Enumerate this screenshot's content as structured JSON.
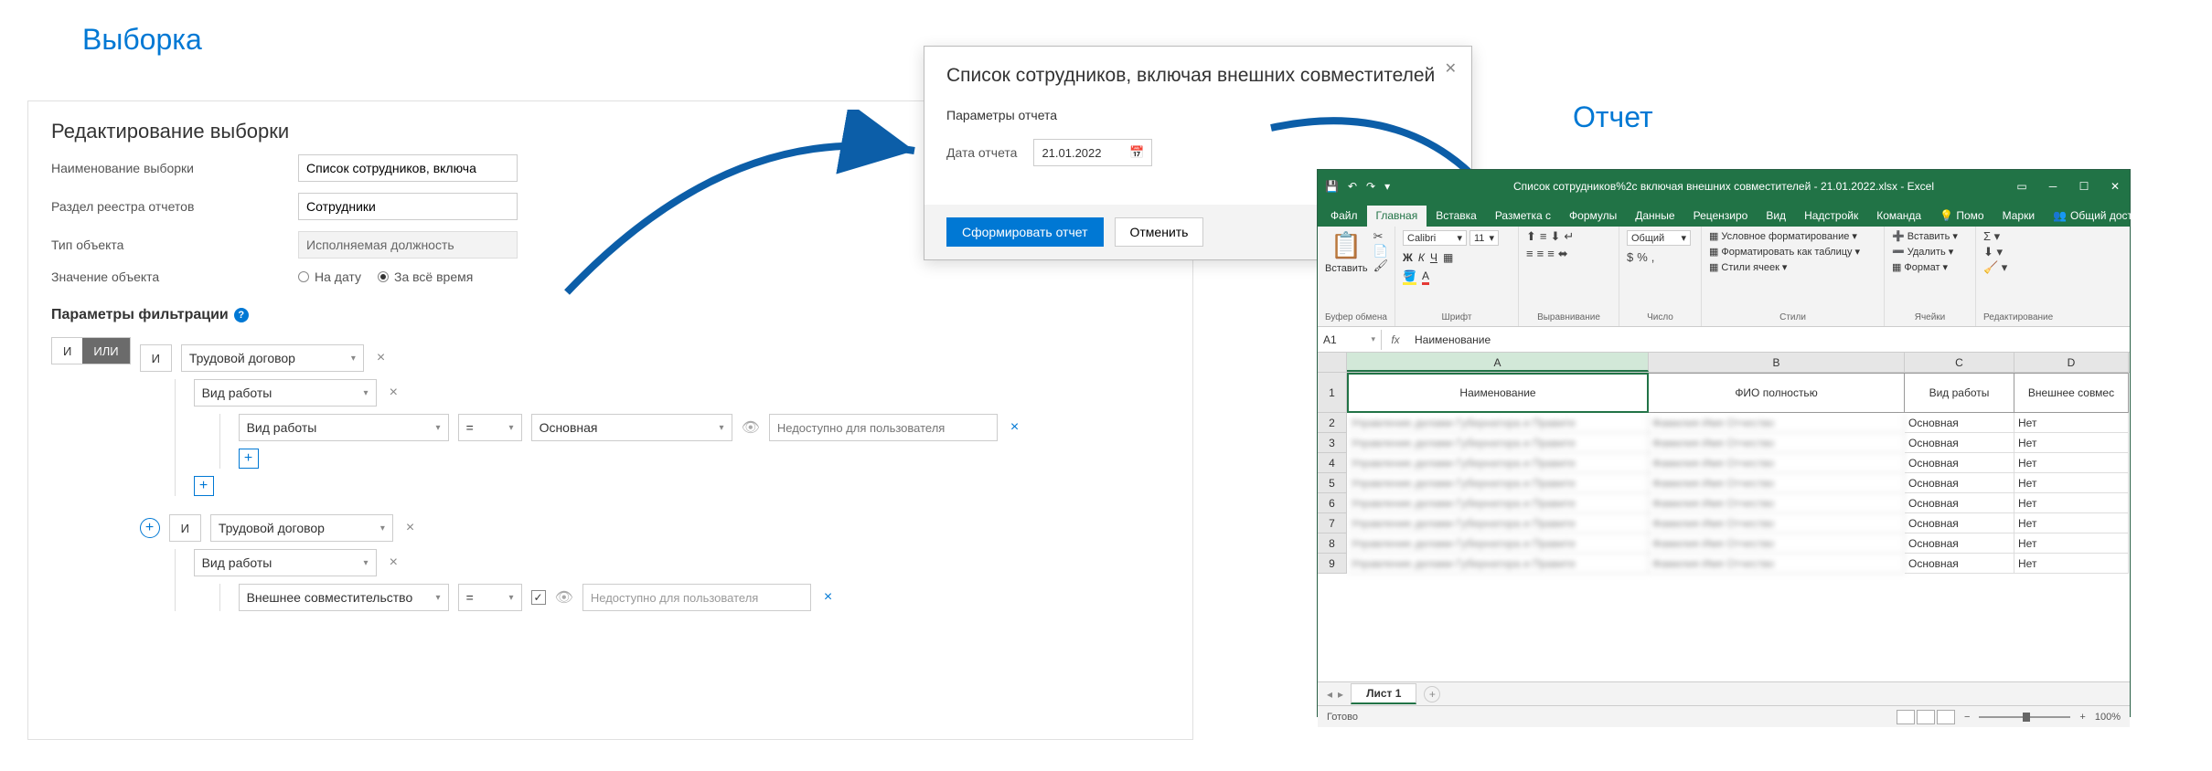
{
  "headings": {
    "selection": "Выборка",
    "report": "Отчет"
  },
  "editor": {
    "title": "Редактирование выборки",
    "name_label": "Наименование выборки",
    "name_value": "Список сотрудников, включа",
    "registry_label": "Раздел реестра отчетов",
    "registry_value": "Сотрудники",
    "objtype_label": "Тип объекта",
    "objtype_value": "Исполняемая должность",
    "objval_label": "Значение объекта",
    "radio_date": "На дату",
    "radio_all": "За всё время",
    "filter_heading": "Параметры фильтрации",
    "logic_and": "И",
    "logic_or": "ИЛИ",
    "contract": "Трудовой договор",
    "work_type": "Вид работы",
    "op_eq": "=",
    "val_main": "Основная",
    "val_external": "Внешнее совместительство",
    "avail_placeholder": "Недоступно для пользователя"
  },
  "modal": {
    "title": "Список сотрудников, включая внешних совместителей",
    "section": "Параметры отчета",
    "date_label": "Дата отчета",
    "date_value": "21.01.2022",
    "btn_generate": "Сформировать отчет",
    "btn_cancel": "Отменить"
  },
  "excel": {
    "title": "Список сотрудников%2c включая внешних совместителей - 21.01.2022.xlsx - Excel",
    "tabs": {
      "file": "Файл",
      "home": "Главная",
      "insert": "Вставка",
      "layout": "Разметка с",
      "formulas": "Формулы",
      "data": "Данные",
      "review": "Рецензиро",
      "view": "Вид",
      "addins": "Надстройк",
      "team": "Команда",
      "tell": "Помо",
      "sign": "Марки",
      "share": "Общий доступ"
    },
    "ribbon": {
      "paste": "Вставить",
      "clipboard": "Буфер обмена",
      "font": "Шрифт",
      "font_name": "Calibri",
      "font_size": "11",
      "alignment": "Выравнивание",
      "number": "Число",
      "number_fmt": "Общий",
      "styles": "Стили",
      "cond_fmt": "Условное форматирование",
      "fmt_table": "Форматировать как таблицу",
      "cell_styles": "Стили ячеек",
      "cells": "Ячейки",
      "insert_cells": "Вставить",
      "delete_cells": "Удалить",
      "format_cells": "Формат",
      "editing": "Редактирование"
    },
    "name_box": "A1",
    "formula": "Наименование",
    "cols": {
      "a": "A",
      "b": "B",
      "c": "C",
      "d": "D"
    },
    "headers": {
      "name": "Наименование",
      "fio": "ФИО полностью",
      "work": "Вид работы",
      "ext": "Внешнее совмес"
    },
    "rows": [
      {
        "r": "2",
        "c": "Основная",
        "d": "Нет"
      },
      {
        "r": "3",
        "c": "Основная",
        "d": "Нет"
      },
      {
        "r": "4",
        "c": "Основная",
        "d": "Нет"
      },
      {
        "r": "5",
        "c": "Основная",
        "d": "Нет"
      },
      {
        "r": "6",
        "c": "Основная",
        "d": "Нет"
      },
      {
        "r": "7",
        "c": "Основная",
        "d": "Нет"
      },
      {
        "r": "8",
        "c": "Основная",
        "d": "Нет"
      },
      {
        "r": "9",
        "c": "Основная",
        "d": "Нет"
      }
    ],
    "sheet_tab": "Лист 1",
    "status": "Готово",
    "zoom": "100%"
  }
}
